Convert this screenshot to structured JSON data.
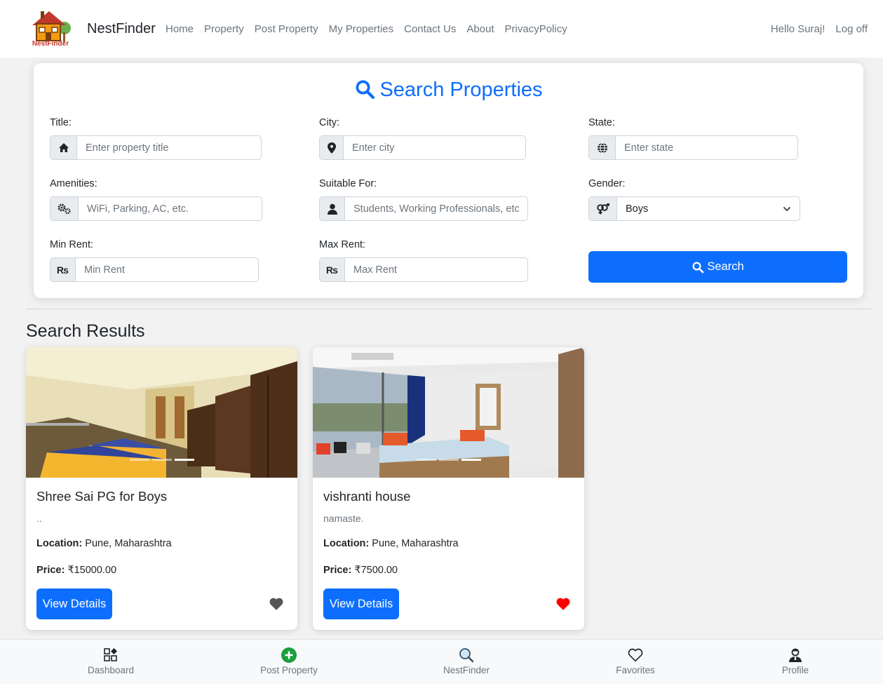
{
  "navbar": {
    "brand": "NestFinder",
    "logo_text": "NestFinder",
    "links": [
      "Home",
      "Property",
      "Post Property",
      "My Properties",
      "Contact Us",
      "About",
      "PrivacyPolicy"
    ],
    "greeting": "Hello Suraj!",
    "logout": "Log off"
  },
  "search": {
    "title": "Search Properties",
    "fields": {
      "title": {
        "label": "Title:",
        "placeholder": "Enter property title",
        "icon": "home-icon"
      },
      "city": {
        "label": "City:",
        "placeholder": "Enter city",
        "icon": "map-pin-icon"
      },
      "state": {
        "label": "State:",
        "placeholder": "Enter state",
        "icon": "globe-icon"
      },
      "amenities": {
        "label": "Amenities:",
        "placeholder": "WiFi, Parking, AC, etc.",
        "icon": "cogs-icon"
      },
      "suitable": {
        "label": "Suitable For:",
        "placeholder": "Students, Working Professionals, etc",
        "icon": "user-icon"
      },
      "gender": {
        "label": "Gender:",
        "value": "Boys",
        "icon": "gender-icon"
      },
      "min_rent": {
        "label": "Min Rent:",
        "placeholder": "Min Rent",
        "icon_text": "₨"
      },
      "max_rent": {
        "label": "Max Rent:",
        "placeholder": "Max Rent",
        "icon_text": "₨"
      }
    },
    "button": "Search"
  },
  "results": {
    "heading": "Search Results",
    "cards": [
      {
        "title": "Shree Sai PG for Boys",
        "description": "..",
        "location_label": "Location:",
        "location": "Pune, Maharashtra",
        "price_label": "Price:",
        "price": "₹15000.00",
        "button": "View Details",
        "favorite": false
      },
      {
        "title": "vishranti house",
        "description": "namaste.",
        "location_label": "Location:",
        "location": "Pune, Maharashtra",
        "price_label": "Price:",
        "price": "₹7500.00",
        "button": "View Details",
        "favorite": true
      }
    ]
  },
  "bottom_nav": [
    {
      "label": "Dashboard",
      "icon": "dashboard-icon"
    },
    {
      "label": "Post Property",
      "icon": "plus-circle-icon"
    },
    {
      "label": "NestFinder",
      "icon": "search-icon"
    },
    {
      "label": "Favorites",
      "icon": "heart-outline-icon"
    },
    {
      "label": "Profile",
      "icon": "profile-icon"
    }
  ],
  "colors": {
    "primary": "#0d6efd",
    "heart_active": "#ff0000",
    "heart_inactive": "#555555",
    "post_green": "#1a9e3e"
  }
}
